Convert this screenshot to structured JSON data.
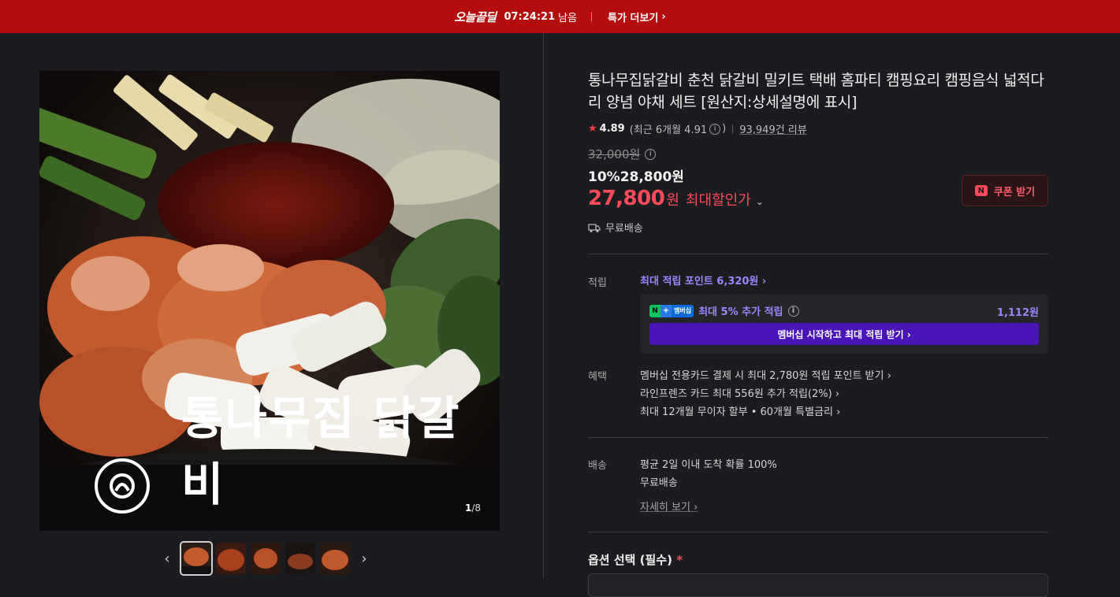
{
  "topbar": {
    "brand": "오늘끝딜",
    "timer": "07:24:21",
    "timer_suffix": "남음",
    "more_label": "특가 더보기",
    "more_chevron": "›"
  },
  "gallery": {
    "logo_text": "통나무집 닭갈비",
    "counter_current": "1",
    "counter_total": "/8",
    "prev_icon": "‹",
    "next_icon": "›"
  },
  "product": {
    "title": "통나무집닭갈비 춘천 닭갈비 밀키트 택배 홈파티 캠핑요리 캠핑음식 넓적다리 양념 야채 세트 [원산지:상세설명에 표시]",
    "rating": {
      "star": "★",
      "score": "4.89",
      "recent": "(최근 6개월 4.91",
      "recent_close": ")",
      "reviews": "93,949건 리뷰"
    },
    "price": {
      "original": "32,000원",
      "sale": "10%28,800원",
      "max": "27,800",
      "max_unit": "원",
      "max_label": "최대할인가"
    },
    "coupon_label": "쿠폰 받기",
    "free_shipping": "무료배송"
  },
  "points": {
    "label": "적립",
    "max_points": "최대 적립 포인트 6,320원 ›",
    "membership_text": "최대 5% 추가 적립",
    "membership_amount": "1,112원",
    "membership_badge": "멤버십",
    "membership_button": "멤버십 시작하고 최대 적립 받기 ›"
  },
  "benefits": {
    "label": "혜택",
    "items": [
      "멤버십 전용카드 결제 시 최대 2,780원 적립 포인트 받기 ›",
      "라인프렌즈 카드 최대 556원 추가 적립(2%) ›",
      "최대 12개월 무이자 할부 • 60개월 특별금리 ›"
    ]
  },
  "shipping": {
    "label": "배송",
    "line1": "평균 2일 이내 도착 확률 100%",
    "line2": "무료배송",
    "more": "자세히 보기 ›"
  },
  "options": {
    "title": "옵션 선택 (필수)",
    "required_mark": "*"
  },
  "colors": {
    "topbar": "#b30d0d",
    "price_red": "#ff4b5c",
    "membership_purple": "#4a14b8",
    "point_purple": "#9d86ff"
  }
}
